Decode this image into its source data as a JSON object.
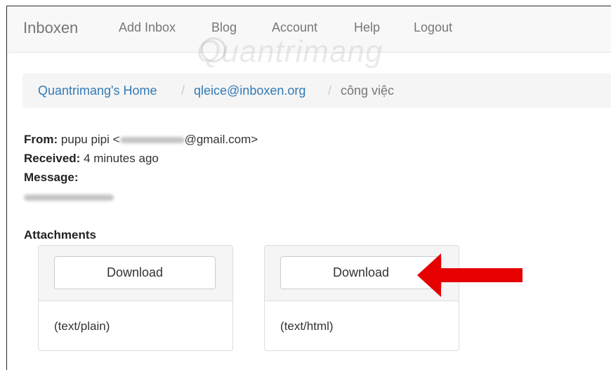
{
  "navbar": {
    "brand": "Inboxen",
    "links": [
      "Add Inbox",
      "Blog",
      "Account",
      "Help",
      "Logout"
    ]
  },
  "breadcrumb": {
    "home": "Quantrimang's Home",
    "inbox": "qleice@inboxen.org",
    "current": "công việc",
    "separator": "/"
  },
  "message": {
    "from_label": "From:",
    "from_name": "pupu pipi <",
    "from_domain": "@gmail.com>",
    "received_label": "Received:",
    "received_value": "4 minutes ago",
    "message_label": "Message:"
  },
  "attachments": {
    "title": "Attachments",
    "items": [
      {
        "button_label": "Download",
        "type": "(text/plain)"
      },
      {
        "button_label": "Download",
        "type": "(text/html)"
      }
    ]
  },
  "watermark": "Quantrimang",
  "colors": {
    "link": "#337ab7",
    "nav_text": "#777777",
    "annotation_arrow": "#e60000"
  },
  "icons": {
    "annotation": "red-arrow-icon"
  }
}
